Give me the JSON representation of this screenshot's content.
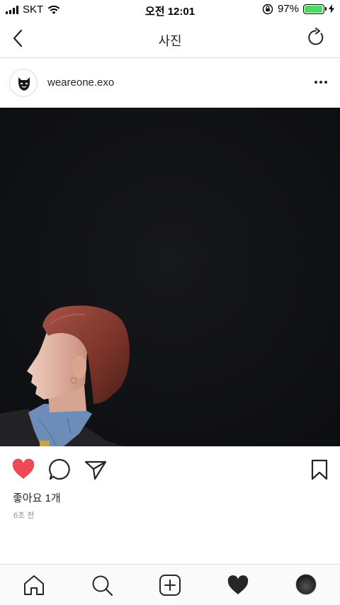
{
  "status_bar": {
    "carrier": "SKT",
    "time": "오전 12:01",
    "battery": "97%",
    "battery_level": 0.97,
    "battery_color": "#4cd964"
  },
  "nav": {
    "title": "사진",
    "back_icon": "chevron-left-icon",
    "refresh_icon": "refresh-icon"
  },
  "post": {
    "username": "weareone.exo",
    "avatar_icon": "exo-logo-icon",
    "more_icon": "more-horizontal-icon",
    "photo_background": "#121316",
    "liked": true,
    "like_color": "#ed4956",
    "likes_text": "좋아요 1개",
    "time_ago": "6초 전"
  },
  "tab_bar": {
    "items": [
      {
        "name": "home",
        "icon": "home-icon"
      },
      {
        "name": "search",
        "icon": "search-icon"
      },
      {
        "name": "new-post",
        "icon": "plus-square-icon"
      },
      {
        "name": "activity",
        "icon": "heart-filled-icon"
      },
      {
        "name": "profile",
        "icon": "profile-avatar"
      }
    ]
  }
}
